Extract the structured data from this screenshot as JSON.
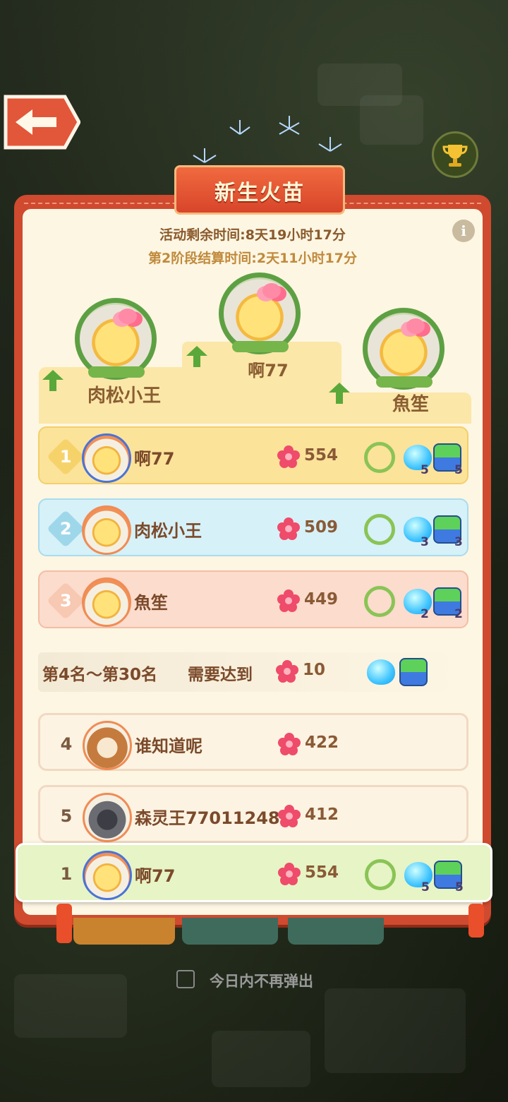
{
  "event": {
    "title": "新生火苗",
    "remaining_time": "活动剩余时间:8天19小时17分",
    "stage_time": "第2阶段结算时间:2天11小时17分"
  },
  "podium": [
    {
      "place": 2,
      "name": "肉松小王"
    },
    {
      "place": 1,
      "name": "啊77"
    },
    {
      "place": 3,
      "name": "魚笙"
    }
  ],
  "leaderboard": [
    {
      "rank": "1",
      "name": "啊77",
      "score": "554",
      "slime": "5",
      "robot": "5"
    },
    {
      "rank": "2",
      "name": "肉松小王",
      "score": "509",
      "slime": "3",
      "robot": "3"
    },
    {
      "rank": "3",
      "name": "魚笙",
      "score": "449",
      "slime": "2",
      "robot": "2"
    }
  ],
  "requirement": {
    "range": "第4名～第30名",
    "need_label": "需要达到",
    "value": "10"
  },
  "others": [
    {
      "rank": "4",
      "name": "谁知道呢",
      "score": "422"
    },
    {
      "rank": "5",
      "name": "森灵王77011248",
      "score": "412"
    }
  ],
  "my_row": {
    "rank": "1",
    "name": "啊77",
    "score": "554",
    "slime": "5",
    "robot": "5"
  },
  "footer": {
    "dont_show_today": "今日内不再弹出"
  },
  "icons": {
    "back": "back-arrow-icon",
    "trophy": "trophy-icon",
    "info": "info-icon",
    "points": "flower-icon",
    "ring": "vine-wreath-icon",
    "slime": "slime-icon",
    "robot": "robot-icon",
    "up": "arrow-up-icon"
  },
  "colors": {
    "panel": "#cf4a2f",
    "gold_row": "#fbe39a",
    "silver_row": "#d6f1f8",
    "bronze_row": "#fbdccd",
    "mine_row": "#e6f4c6"
  }
}
